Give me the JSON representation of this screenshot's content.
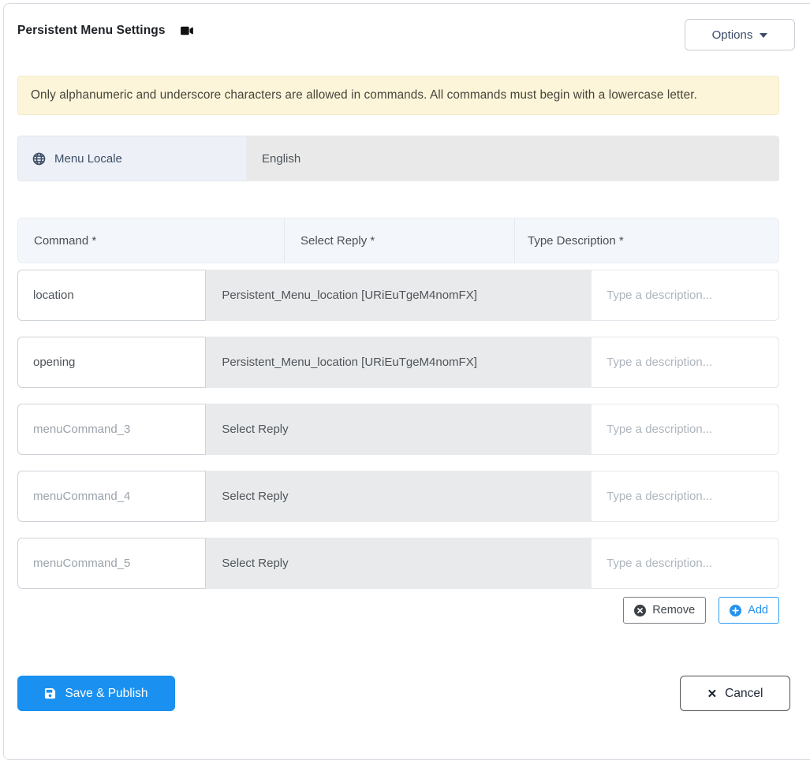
{
  "header": {
    "title": "Persistent Menu Settings",
    "options_button": "Options"
  },
  "banner": {
    "text": "Only alphanumeric and underscore characters are allowed in commands. All commands must begin with a lowercase letter."
  },
  "locale": {
    "label": "Menu Locale",
    "value": "English"
  },
  "table": {
    "columns": [
      "Command *",
      "Select Reply *",
      "Type Description *"
    ],
    "description_placeholder": "Type a description...",
    "rows": [
      {
        "command": "location",
        "command_muted": false,
        "reply": "Persistent_Menu_location [URiEuTgeM4nomFX]",
        "reply_set": true
      },
      {
        "command": "opening",
        "command_muted": false,
        "reply": "Persistent_Menu_location [URiEuTgeM4nomFX]",
        "reply_set": true
      },
      {
        "command": "menuCommand_3",
        "command_muted": true,
        "reply": "Select Reply",
        "reply_set": false
      },
      {
        "command": "menuCommand_4",
        "command_muted": true,
        "reply": "Select Reply",
        "reply_set": false
      },
      {
        "command": "menuCommand_5",
        "command_muted": true,
        "reply": "Select Reply",
        "reply_set": false
      }
    ]
  },
  "row_actions": {
    "remove": "Remove",
    "add": "Add"
  },
  "footer": {
    "save": "Save & Publish",
    "cancel": "Cancel"
  },
  "icons": {
    "title": "video-camera-icon",
    "locale": "globe-icon",
    "remove": "x-circle-icon",
    "add": "plus-circle-icon",
    "save": "floppy-disk-icon",
    "cancel": "x-icon",
    "options": "chevron-down-icon"
  },
  "colors": {
    "primary_blue": "#1a91f0",
    "add_blue": "#2492f0",
    "banner_bg": "#fcf5d9",
    "table_header_bg": "#f3f7fb",
    "locale_label_bg": "#edf1f7",
    "disabled_field_gray": "#e9e9e9",
    "card_border": "#d8dce2"
  }
}
